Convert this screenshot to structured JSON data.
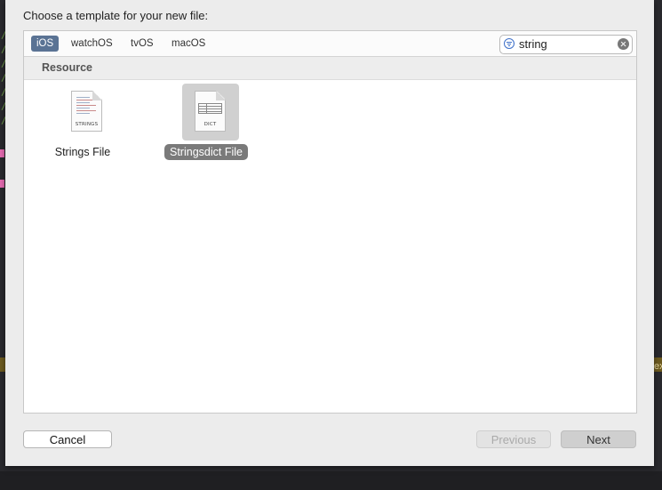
{
  "sheet": {
    "title": "Choose a template for your new file:"
  },
  "platform_tabs": [
    {
      "label": "iOS",
      "selected": true
    },
    {
      "label": "watchOS",
      "selected": false
    },
    {
      "label": "tvOS",
      "selected": false
    },
    {
      "label": "macOS",
      "selected": false
    }
  ],
  "search": {
    "value": "string",
    "placeholder": "Filter"
  },
  "section": {
    "title": "Resource"
  },
  "templates": [
    {
      "name": "Strings File",
      "icon": "strings-file-icon",
      "caption": "STRINGS",
      "selected": false
    },
    {
      "name": "Stringsdict File",
      "icon": "stringsdict-file-icon",
      "caption": "DICT",
      "selected": true
    }
  ],
  "buttons": {
    "cancel": "Cancel",
    "previous": "Previous",
    "next": "Next"
  },
  "editor": {
    "overflow_text": "ex"
  },
  "colors": {
    "accent_tab": "#5a7394",
    "selected_label": "#7a7a7a"
  }
}
